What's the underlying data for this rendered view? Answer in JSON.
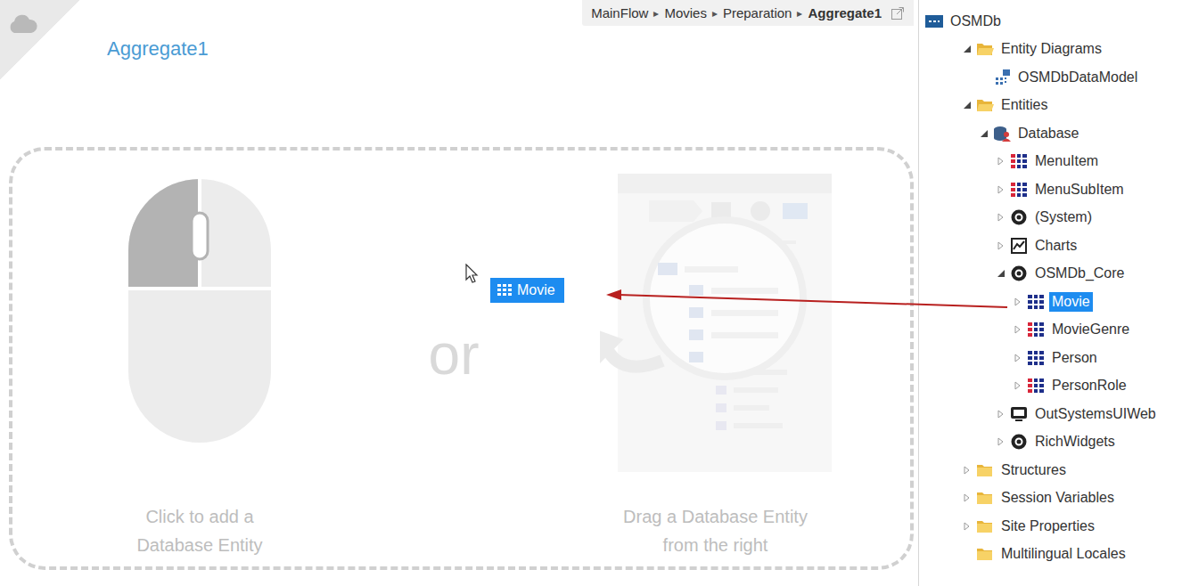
{
  "editor": {
    "title": "Aggregate1",
    "breadcrumb": {
      "items": [
        "MainFlow",
        "Movies",
        "Preparation",
        "Aggregate1"
      ],
      "separator": "▸"
    },
    "drop_zone": {
      "left_caption": [
        "Click to add a",
        "Database Entity"
      ],
      "or": "or",
      "right_caption": [
        "Drag a Database Entity",
        "from the right"
      ]
    },
    "dragged_item": {
      "label": "Movie"
    }
  },
  "tree": [
    {
      "label": "OSMDb",
      "depth": 0,
      "kind": "module",
      "expandable": false,
      "expanded": true,
      "selected": false
    },
    {
      "label": "Entity Diagrams",
      "depth": 1,
      "kind": "folder",
      "expandable": true,
      "expanded": true,
      "selected": false
    },
    {
      "label": "OSMDbDataModel",
      "depth": 2,
      "kind": "diagram",
      "expandable": false,
      "expanded": false,
      "selected": false
    },
    {
      "label": "Entities",
      "depth": 1,
      "kind": "folder",
      "expandable": true,
      "expanded": true,
      "selected": false
    },
    {
      "label": "Database",
      "depth": 2,
      "kind": "database",
      "expandable": true,
      "expanded": true,
      "selected": false
    },
    {
      "label": "MenuItem",
      "depth": 3,
      "kind": "static-entity",
      "expandable": true,
      "expanded": false,
      "selected": false
    },
    {
      "label": "MenuSubItem",
      "depth": 3,
      "kind": "static-entity",
      "expandable": true,
      "expanded": false,
      "selected": false
    },
    {
      "label": "(System)",
      "depth": 3,
      "kind": "module-ref",
      "expandable": true,
      "expanded": false,
      "selected": false
    },
    {
      "label": "Charts",
      "depth": 3,
      "kind": "charts",
      "expandable": true,
      "expanded": false,
      "selected": false
    },
    {
      "label": "OSMDb_Core",
      "depth": 3,
      "kind": "module-ref",
      "expandable": true,
      "expanded": true,
      "selected": false
    },
    {
      "label": "Movie",
      "depth": 4,
      "kind": "entity",
      "expandable": true,
      "expanded": false,
      "selected": true
    },
    {
      "label": "MovieGenre",
      "depth": 4,
      "kind": "static-entity",
      "expandable": true,
      "expanded": false,
      "selected": false
    },
    {
      "label": "Person",
      "depth": 4,
      "kind": "entity",
      "expandable": true,
      "expanded": false,
      "selected": false
    },
    {
      "label": "PersonRole",
      "depth": 4,
      "kind": "static-entity",
      "expandable": true,
      "expanded": false,
      "selected": false
    },
    {
      "label": "OutSystemsUIWeb",
      "depth": 3,
      "kind": "web-ref",
      "expandable": true,
      "expanded": false,
      "selected": false
    },
    {
      "label": "RichWidgets",
      "depth": 3,
      "kind": "module-ref",
      "expandable": true,
      "expanded": false,
      "selected": false
    },
    {
      "label": "Structures",
      "depth": 1,
      "kind": "folder",
      "expandable": true,
      "expanded": false,
      "selected": false
    },
    {
      "label": "Session Variables",
      "depth": 1,
      "kind": "folder",
      "expandable": true,
      "expanded": false,
      "selected": false
    },
    {
      "label": "Site Properties",
      "depth": 1,
      "kind": "folder",
      "expandable": true,
      "expanded": false,
      "selected": false
    },
    {
      "label": "Multilingual Locales",
      "depth": 1,
      "kind": "folder",
      "expandable": false,
      "expanded": false,
      "selected": false
    }
  ]
}
